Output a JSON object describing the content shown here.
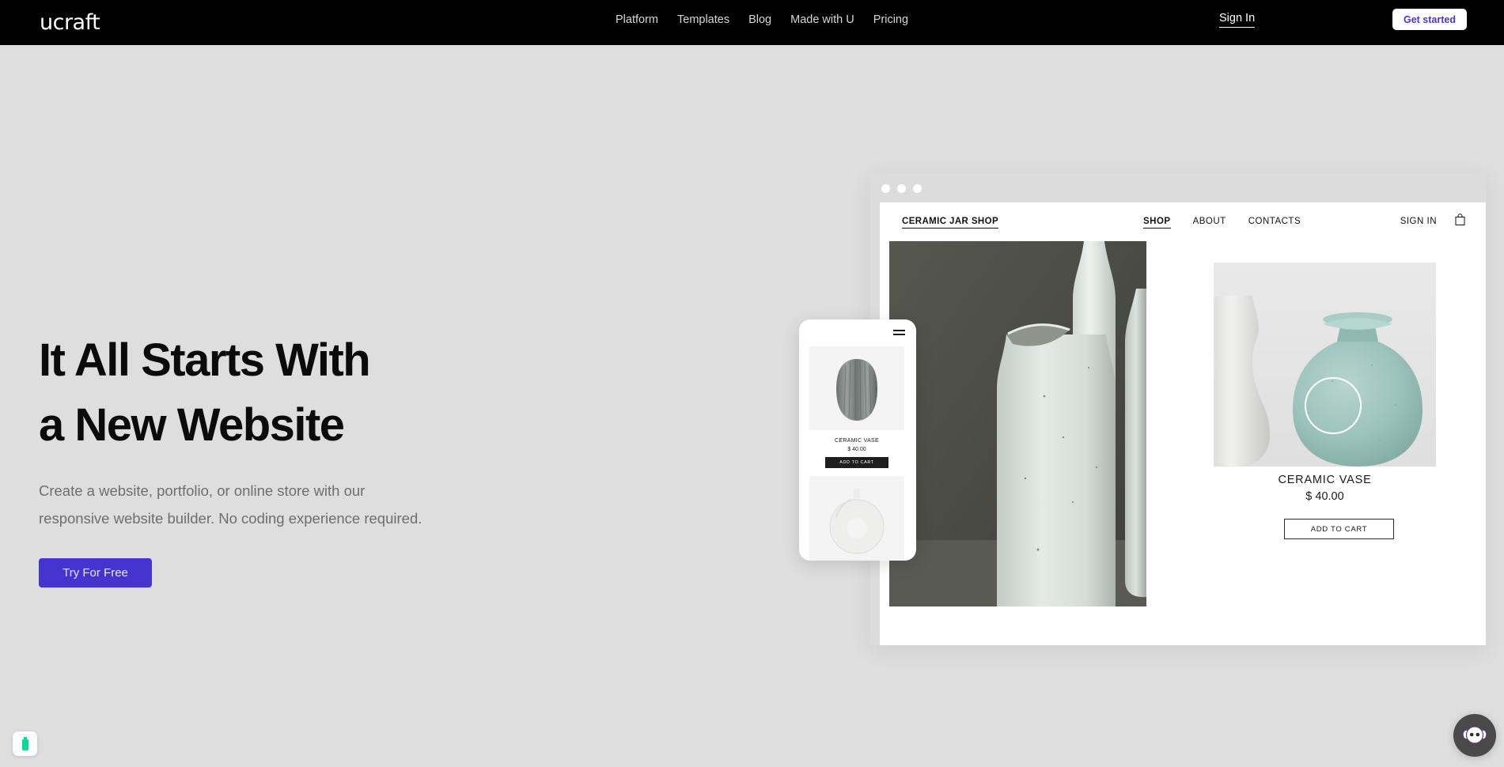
{
  "brand": {
    "logo": "ucraft"
  },
  "nav": {
    "items": [
      {
        "label": "Platform"
      },
      {
        "label": "Templates"
      },
      {
        "label": "Blog"
      },
      {
        "label": "Made with U"
      },
      {
        "label": "Pricing"
      }
    ],
    "sign_in": "Sign In",
    "get_started": "Get started"
  },
  "hero": {
    "headline": "It All Starts With\na New Website",
    "subtext": "Create a website, portfolio, or online store with our\nresponsive website builder. No coding experience required.",
    "cta": "Try For Free"
  },
  "mockup": {
    "shop": {
      "brand": "CERAMIC JAR SHOP",
      "nav": [
        {
          "label": "SHOP",
          "active": true
        },
        {
          "label": "ABOUT",
          "active": false
        },
        {
          "label": "CONTACTS",
          "active": false
        }
      ],
      "sign_in": "SIGN IN",
      "bag_icon": "shopping-bag-icon"
    },
    "product": {
      "title": "CERAMIC VASE",
      "price": "$ 40.00",
      "add_to_cart": "ADD TO CART"
    },
    "mobile": {
      "menu_icon": "hamburger-menu-icon",
      "product": {
        "title": "CERAMIC VASE",
        "price": "$ 40.00",
        "add_to_cart": "ADD TO CART"
      }
    }
  },
  "widgets": {
    "accessibility_badge_icon": "accessibility-badge-icon",
    "chat_icon": "chat-monkey-icon"
  },
  "colors": {
    "header_bg": "#000000",
    "page_bg": "#dedede",
    "accent_purple": "#4634d0",
    "get_started_text": "#4a34d8",
    "badge_green": "#00dc9a",
    "chat_bg": "#4a4a4a"
  }
}
